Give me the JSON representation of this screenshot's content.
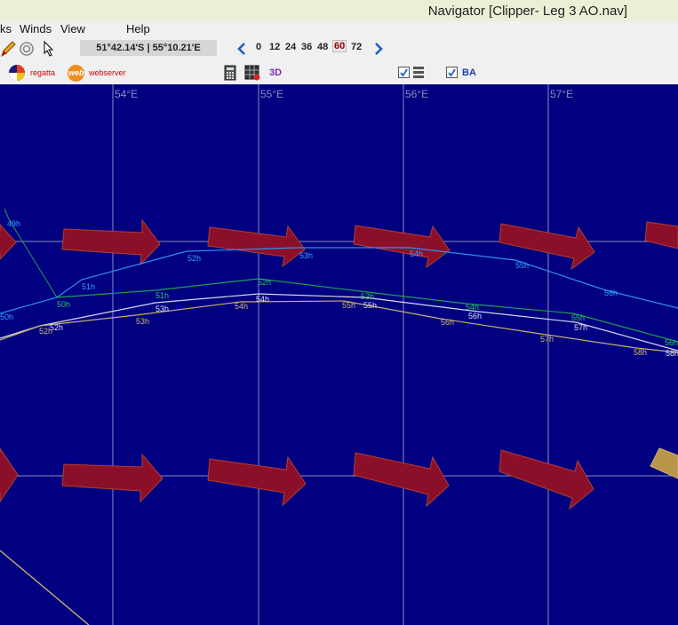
{
  "window": {
    "title": "Navigator [Clipper- Leg 3 AO.nav]"
  },
  "menu": {
    "items": [
      "ks",
      "Winds",
      "View",
      "Help"
    ]
  },
  "toolbar": {
    "icons": [
      "pencil-icon",
      "target-icon",
      "cursor-icon"
    ],
    "coordinates": "51°42.14'S | 55°10.21'E",
    "time_steps": [
      "0",
      "12",
      "24",
      "36",
      "48",
      "60",
      "72"
    ],
    "selected_time_step": "60"
  },
  "toolbar2": {
    "regatta_label": "regatta",
    "webserver_label": "webserver",
    "web_badge": "web",
    "three_d_label": "3D",
    "ba_label": "BA",
    "ba_checked": true,
    "layers_checked": true
  },
  "map": {
    "longitude_labels": [
      "54°E",
      "55°E",
      "56°E",
      "57°E"
    ],
    "background_color": "#000080",
    "route_labels": {
      "blue": [
        "49h",
        "50h",
        "51h",
        "52h",
        "53h",
        "54h",
        "55h",
        "56h"
      ],
      "green": [
        "50h",
        "51h",
        "52h",
        "53h",
        "54h",
        "55h",
        "56h"
      ],
      "white": [
        "52h",
        "53h",
        "54h",
        "55h",
        "56h",
        "57h",
        "58h"
      ],
      "tan": [
        "52h",
        "53h",
        "54h",
        "55h",
        "56h",
        "57h",
        "58h"
      ]
    }
  }
}
